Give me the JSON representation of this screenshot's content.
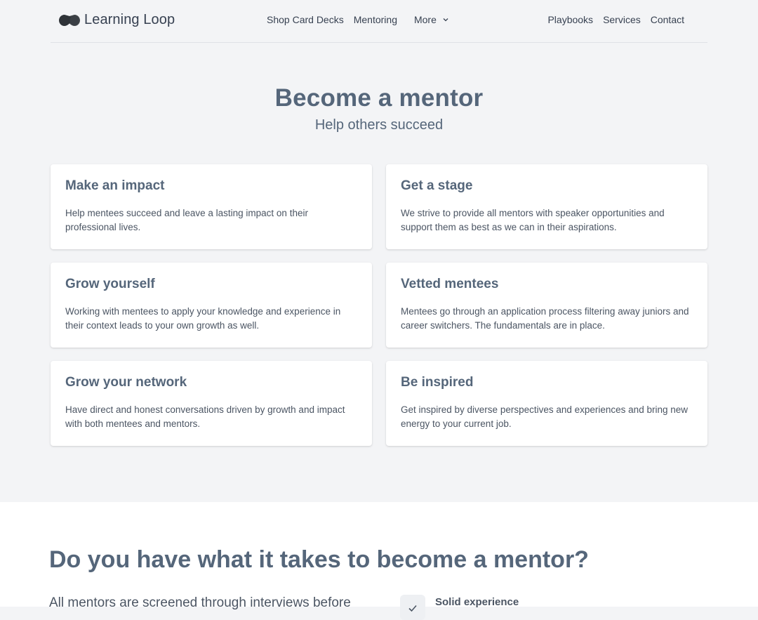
{
  "brand": {
    "name": "Learning Loop",
    "logo_icon": "loop-logo-icon"
  },
  "nav": {
    "center": [
      "Shop Card Decks",
      "Mentoring"
    ],
    "more_label": "More",
    "right": [
      "Playbooks",
      "Services",
      "Contact"
    ]
  },
  "hero": {
    "title": "Become a mentor",
    "subtitle": "Help others succeed"
  },
  "cards": [
    {
      "title": "Make an impact",
      "text": "Help mentees succeed and leave a lasting impact on their professional lives."
    },
    {
      "title": "Get a stage",
      "text": "We strive to provide all mentors with speaker opportunities and support them as best as we can in their aspirations."
    },
    {
      "title": "Grow yourself",
      "text": "Working with mentees to apply your knowledge and experience in their context leads to your own growth as well."
    },
    {
      "title": "Vetted mentees",
      "text": "Mentees go through an application process filtering away juniors and career switchers. The fundamentals are in place."
    },
    {
      "title": "Grow your network",
      "text": "Have direct and honest conversations driven by growth and impact with both mentees and mentors."
    },
    {
      "title": "Be inspired",
      "text": "Get inspired by diverse perspectives and experiences and bring new energy to your current job."
    }
  ],
  "requirements": {
    "title": "Do you have what it takes to become a mentor?",
    "intro": "All mentors are screened through interviews before",
    "feature_title": "Solid experience",
    "feature_icon": "check-icon"
  },
  "colors": {
    "background": "#f3f4f6",
    "heading": "#55667a",
    "card": "#ffffff"
  }
}
